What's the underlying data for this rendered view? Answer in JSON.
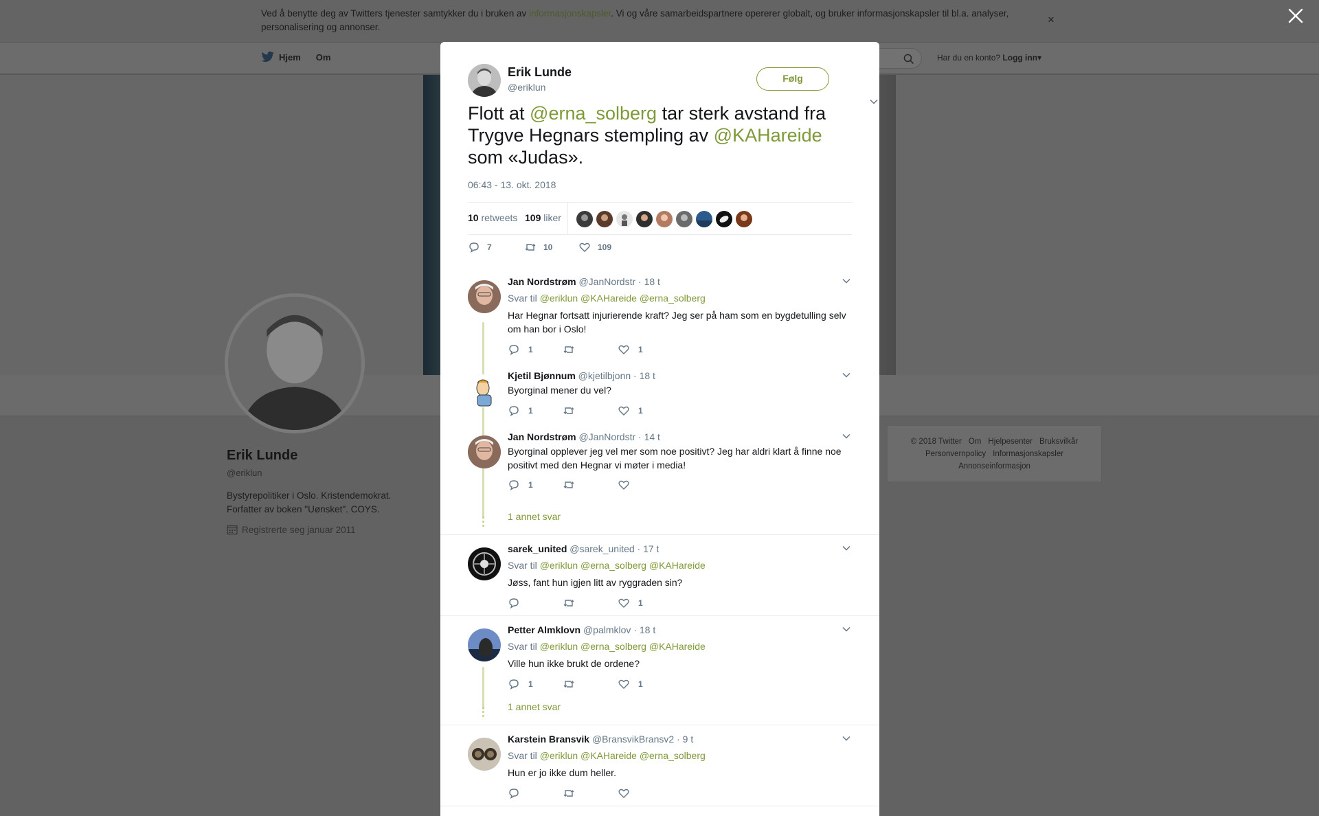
{
  "cookie": {
    "text_before": "Ved å benytte deg av Twitters tjenester samtykker du i bruken av ",
    "link": "informasjonskapsler",
    "text_after": ". Vi og våre samarbeidspartnere opererer globalt, og bruker informasjonskapsler til bl.a. analyser, personalisering og annonser.",
    "close": "×"
  },
  "nav": {
    "home": "Hjem",
    "about": "Om",
    "account_prompt": "Har du en konto?",
    "login": "Logg inn"
  },
  "profile": {
    "name": "Erik Lunde",
    "handle": "@eriklun",
    "bio_line1": "Bystyrepolitiker i Oslo. Kristendemokrat.",
    "bio_line2": "Forfatter av boken \"Uønsket\". COYS.",
    "joined": "Registrerte seg januar 2011"
  },
  "footer": {
    "links": [
      "© 2018 Twitter",
      "Om",
      "Hjelpesenter",
      "Bruksvilkår",
      "Personvernpolicy",
      "Informasjonskapsler",
      "Annonseinformasjon"
    ]
  },
  "tweet": {
    "name": "Erik Lunde",
    "handle": "@eriklun",
    "follow": "Følg",
    "text_1": "Flott at ",
    "mention_1": "@erna_solberg",
    "text_2": " tar sterk avstand fra Trygve Hegnars stempling av ",
    "mention_2": "@KAHareide",
    "text_3": " som «Judas».",
    "time": "06:43 - 13. okt. 2018",
    "retweets_count": "10",
    "retweets_label": "retweets",
    "likes_count": "109",
    "likes_label": "liker",
    "actions": {
      "reply": "7",
      "retweet": "10",
      "like": "109"
    }
  },
  "replies": [
    {
      "name": "Jan Nordstrøm",
      "handle": "@JanNordstr",
      "time": "· 18 t",
      "to_label": "Svar til",
      "to": "@eriklun @KAHareide @erna_solberg",
      "text": "Har Hegnar fortsatt injurierende kraft? Jeg ser på ham som en bygdetulling selv om han bor i Oslo!",
      "reply_count": "1",
      "retweet_count": "",
      "like_count": "1"
    },
    {
      "name": "Kjetil Bjønnum",
      "handle": "@kjetilbjonn",
      "time": "· 18 t",
      "text": "Byorginal mener du vel?",
      "reply_count": "1",
      "retweet_count": "",
      "like_count": "1"
    },
    {
      "name": "Jan Nordstrøm",
      "handle": "@JanNordstr",
      "time": "· 14 t",
      "text": "Byorginal opplever jeg vel mer som noe positivt? Jeg har aldri klart å finne noe positivt med den Hegnar vi møter i media!",
      "reply_count": "1",
      "retweet_count": "",
      "like_count": "",
      "more": "1 annet svar"
    },
    {
      "name": "sarek_united",
      "handle": "@sarek_united",
      "time": "· 17 t",
      "to_label": "Svar til",
      "to": "@eriklun @erna_solberg @KAHareide",
      "text": "Jøss, fant hun igjen litt av ryggraden sin?",
      "reply_count": "",
      "retweet_count": "",
      "like_count": "1"
    },
    {
      "name": "Petter Almklovn",
      "handle": "@palmklov",
      "time": "· 18 t",
      "to_label": "Svar til",
      "to": "@eriklun @erna_solberg @KAHareide",
      "text": "Ville hun ikke brukt de ordene?",
      "reply_count": "1",
      "retweet_count": "",
      "like_count": "1",
      "more": "1 annet svar"
    },
    {
      "name": "Karstein Bransvik",
      "handle": "@BransvikBransv2",
      "time": "· 9 t",
      "to_label": "Svar til",
      "to": "@eriklun @KAHareide @erna_solberg",
      "text": "Hun er jo ikke dum heller.",
      "reply_count": "",
      "retweet_count": "",
      "like_count": ""
    }
  ],
  "colors": {
    "accent": "#7e9a38",
    "muted": "#657786",
    "overlay": "#626262"
  }
}
